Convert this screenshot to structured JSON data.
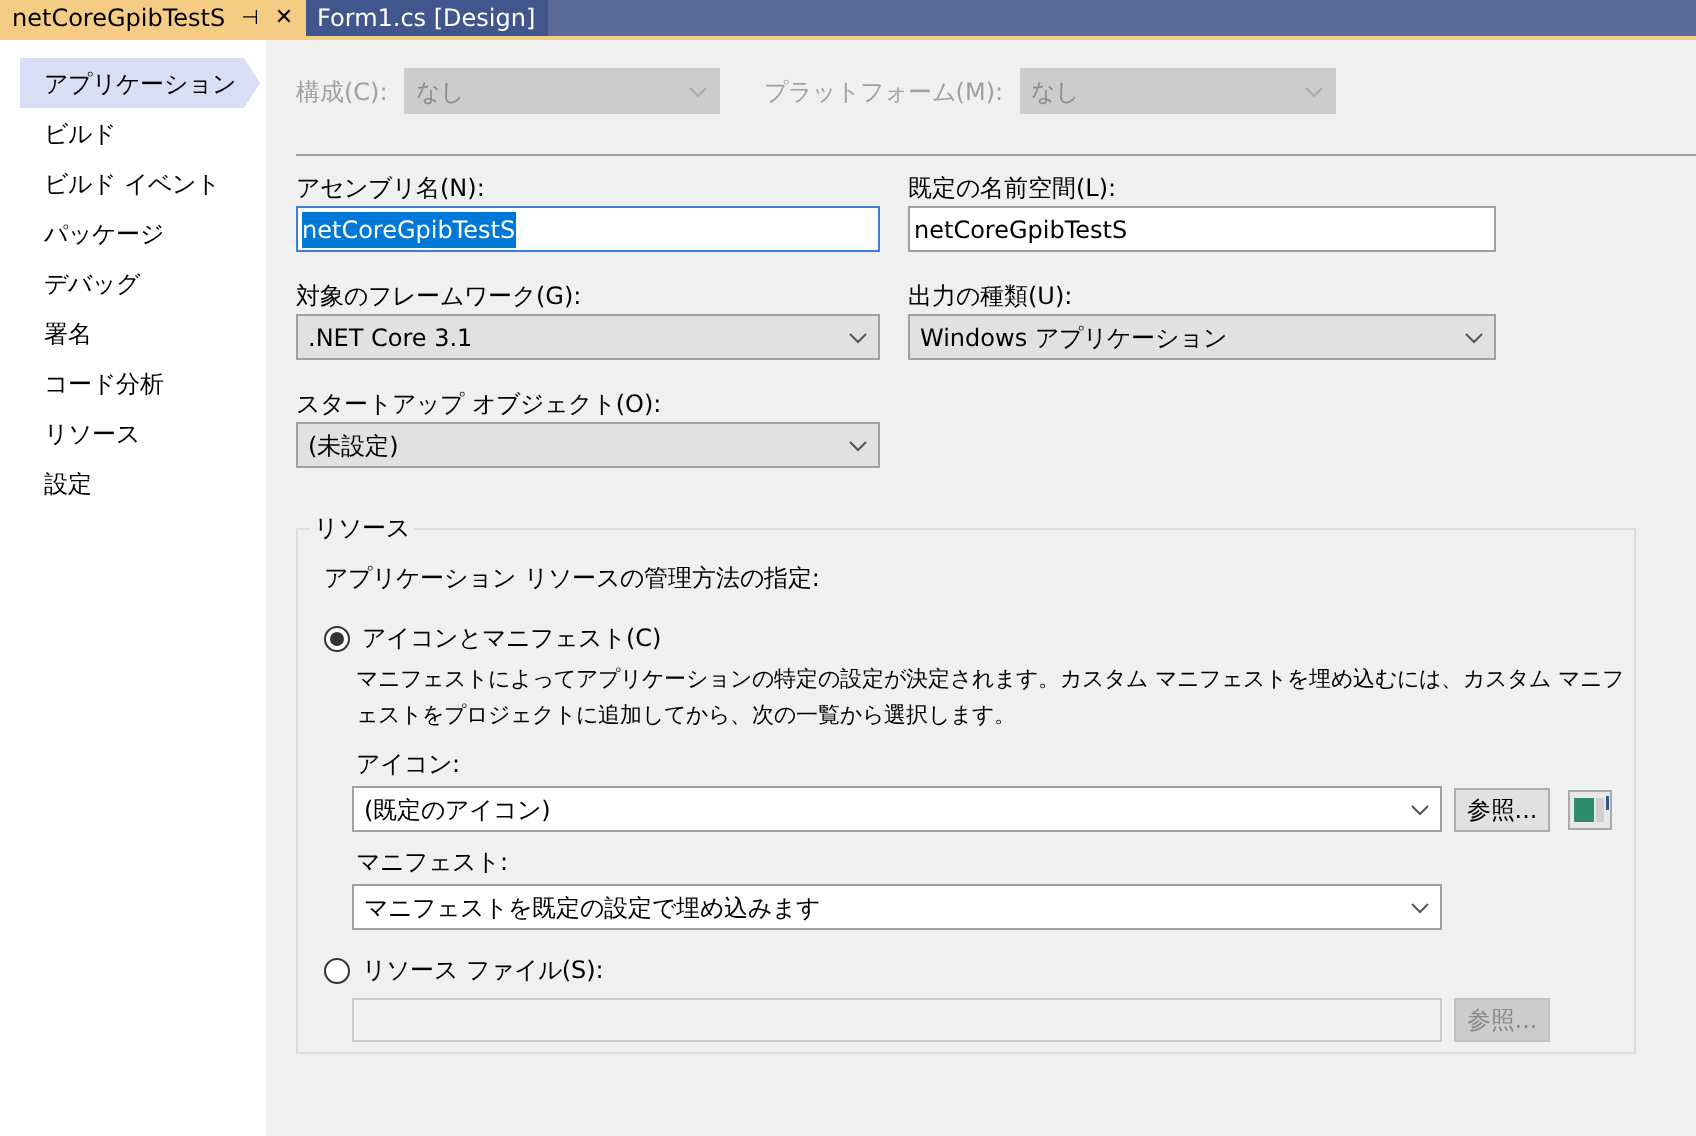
{
  "tabs": [
    {
      "label": "netCoreGpibTestS",
      "selected": true,
      "pin": "⊣",
      "close": "✕"
    },
    {
      "label": "Form1.cs [Design]",
      "selected": false
    }
  ],
  "sidebar": {
    "items": [
      {
        "label": "アプリケーション",
        "selected": true
      },
      {
        "label": "ビルド",
        "selected": false
      },
      {
        "label": "ビルド イベント",
        "selected": false
      },
      {
        "label": "パッケージ",
        "selected": false
      },
      {
        "label": "デバッグ",
        "selected": false
      },
      {
        "label": "署名",
        "selected": false
      },
      {
        "label": "コード分析",
        "selected": false
      },
      {
        "label": "リソース",
        "selected": false
      },
      {
        "label": "設定",
        "selected": false
      }
    ]
  },
  "config_row": [
    {
      "label": "構成(C):",
      "value": "なし",
      "disabled": true
    },
    {
      "label": "プラットフォーム(M):",
      "value": "なし",
      "disabled": true
    }
  ],
  "fields": [
    {
      "label": "アセンブリ名(N):",
      "kind": "text",
      "value": "netCoreGpibTestS",
      "highlighted": true
    },
    {
      "label": "既定の名前空間(L):",
      "kind": "text",
      "value": "netCoreGpibTestS",
      "highlighted": false
    },
    {
      "label": "対象のフレームワーク(G):",
      "kind": "combo",
      "value": ".NET Core 3.1",
      "highlighted": false
    },
    {
      "label": "出力の種類(U):",
      "kind": "combo",
      "value": "Windows アプリケーション",
      "highlighted": false
    },
    {
      "label": "スタートアップ オブジェクト(O):",
      "kind": "combo",
      "value": "(未設定)",
      "highlighted": false
    }
  ],
  "resources": {
    "title": "リソース",
    "prompt": "アプリケーション リソースの管理方法の指定:",
    "options": [
      {
        "label": "アイコンとマニフェスト(C)",
        "selected": true,
        "description_lines": [
          "マニフェストによってアプリケーションの特定の設定が決定されます。カスタム マニフェストを埋め込むには、カスタム マニフ",
          "ェストをプロジェクトに追加してから、次の一覧から選択します。"
        ]
      },
      {
        "label": "リソース ファイル(S):",
        "selected": false
      }
    ],
    "icon": {
      "label": "アイコン:",
      "value": "(既定のアイコン)",
      "button": "参照..."
    },
    "manifest": {
      "label": "マニフェスト:",
      "value": "マニフェストを既定の設定で埋め込みます"
    },
    "resource_file": {
      "button": "参照...",
      "disabled": true
    }
  }
}
